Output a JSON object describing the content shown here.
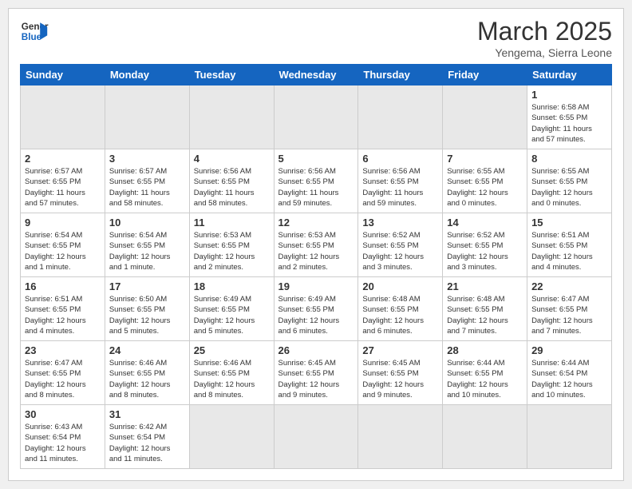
{
  "header": {
    "logo_general": "General",
    "logo_blue": "Blue",
    "month_title": "March 2025",
    "location": "Yengema, Sierra Leone"
  },
  "weekdays": [
    "Sunday",
    "Monday",
    "Tuesday",
    "Wednesday",
    "Thursday",
    "Friday",
    "Saturday"
  ],
  "weeks": [
    [
      {
        "day": "",
        "info": "",
        "empty": true
      },
      {
        "day": "",
        "info": "",
        "empty": true
      },
      {
        "day": "",
        "info": "",
        "empty": true
      },
      {
        "day": "",
        "info": "",
        "empty": true
      },
      {
        "day": "",
        "info": "",
        "empty": true
      },
      {
        "day": "",
        "info": "",
        "empty": true
      },
      {
        "day": "1",
        "info": "Sunrise: 6:58 AM\nSunset: 6:55 PM\nDaylight: 11 hours\nand 57 minutes."
      }
    ],
    [
      {
        "day": "2",
        "info": "Sunrise: 6:57 AM\nSunset: 6:55 PM\nDaylight: 11 hours\nand 57 minutes."
      },
      {
        "day": "3",
        "info": "Sunrise: 6:57 AM\nSunset: 6:55 PM\nDaylight: 11 hours\nand 58 minutes."
      },
      {
        "day": "4",
        "info": "Sunrise: 6:56 AM\nSunset: 6:55 PM\nDaylight: 11 hours\nand 58 minutes."
      },
      {
        "day": "5",
        "info": "Sunrise: 6:56 AM\nSunset: 6:55 PM\nDaylight: 11 hours\nand 59 minutes."
      },
      {
        "day": "6",
        "info": "Sunrise: 6:56 AM\nSunset: 6:55 PM\nDaylight: 11 hours\nand 59 minutes."
      },
      {
        "day": "7",
        "info": "Sunrise: 6:55 AM\nSunset: 6:55 PM\nDaylight: 12 hours\nand 0 minutes."
      },
      {
        "day": "8",
        "info": "Sunrise: 6:55 AM\nSunset: 6:55 PM\nDaylight: 12 hours\nand 0 minutes."
      }
    ],
    [
      {
        "day": "9",
        "info": "Sunrise: 6:54 AM\nSunset: 6:55 PM\nDaylight: 12 hours\nand 1 minute."
      },
      {
        "day": "10",
        "info": "Sunrise: 6:54 AM\nSunset: 6:55 PM\nDaylight: 12 hours\nand 1 minute."
      },
      {
        "day": "11",
        "info": "Sunrise: 6:53 AM\nSunset: 6:55 PM\nDaylight: 12 hours\nand 2 minutes."
      },
      {
        "day": "12",
        "info": "Sunrise: 6:53 AM\nSunset: 6:55 PM\nDaylight: 12 hours\nand 2 minutes."
      },
      {
        "day": "13",
        "info": "Sunrise: 6:52 AM\nSunset: 6:55 PM\nDaylight: 12 hours\nand 3 minutes."
      },
      {
        "day": "14",
        "info": "Sunrise: 6:52 AM\nSunset: 6:55 PM\nDaylight: 12 hours\nand 3 minutes."
      },
      {
        "day": "15",
        "info": "Sunrise: 6:51 AM\nSunset: 6:55 PM\nDaylight: 12 hours\nand 4 minutes."
      }
    ],
    [
      {
        "day": "16",
        "info": "Sunrise: 6:51 AM\nSunset: 6:55 PM\nDaylight: 12 hours\nand 4 minutes."
      },
      {
        "day": "17",
        "info": "Sunrise: 6:50 AM\nSunset: 6:55 PM\nDaylight: 12 hours\nand 5 minutes."
      },
      {
        "day": "18",
        "info": "Sunrise: 6:49 AM\nSunset: 6:55 PM\nDaylight: 12 hours\nand 5 minutes."
      },
      {
        "day": "19",
        "info": "Sunrise: 6:49 AM\nSunset: 6:55 PM\nDaylight: 12 hours\nand 6 minutes."
      },
      {
        "day": "20",
        "info": "Sunrise: 6:48 AM\nSunset: 6:55 PM\nDaylight: 12 hours\nand 6 minutes."
      },
      {
        "day": "21",
        "info": "Sunrise: 6:48 AM\nSunset: 6:55 PM\nDaylight: 12 hours\nand 7 minutes."
      },
      {
        "day": "22",
        "info": "Sunrise: 6:47 AM\nSunset: 6:55 PM\nDaylight: 12 hours\nand 7 minutes."
      }
    ],
    [
      {
        "day": "23",
        "info": "Sunrise: 6:47 AM\nSunset: 6:55 PM\nDaylight: 12 hours\nand 8 minutes."
      },
      {
        "day": "24",
        "info": "Sunrise: 6:46 AM\nSunset: 6:55 PM\nDaylight: 12 hours\nand 8 minutes."
      },
      {
        "day": "25",
        "info": "Sunrise: 6:46 AM\nSunset: 6:55 PM\nDaylight: 12 hours\nand 8 minutes."
      },
      {
        "day": "26",
        "info": "Sunrise: 6:45 AM\nSunset: 6:55 PM\nDaylight: 12 hours\nand 9 minutes."
      },
      {
        "day": "27",
        "info": "Sunrise: 6:45 AM\nSunset: 6:55 PM\nDaylight: 12 hours\nand 9 minutes."
      },
      {
        "day": "28",
        "info": "Sunrise: 6:44 AM\nSunset: 6:55 PM\nDaylight: 12 hours\nand 10 minutes."
      },
      {
        "day": "29",
        "info": "Sunrise: 6:44 AM\nSunset: 6:54 PM\nDaylight: 12 hours\nand 10 minutes."
      }
    ],
    [
      {
        "day": "30",
        "info": "Sunrise: 6:43 AM\nSunset: 6:54 PM\nDaylight: 12 hours\nand 11 minutes."
      },
      {
        "day": "31",
        "info": "Sunrise: 6:42 AM\nSunset: 6:54 PM\nDaylight: 12 hours\nand 11 minutes."
      },
      {
        "day": "",
        "info": "",
        "empty": true
      },
      {
        "day": "",
        "info": "",
        "empty": true
      },
      {
        "day": "",
        "info": "",
        "empty": true
      },
      {
        "day": "",
        "info": "",
        "empty": true
      },
      {
        "day": "",
        "info": "",
        "empty": true
      }
    ]
  ]
}
